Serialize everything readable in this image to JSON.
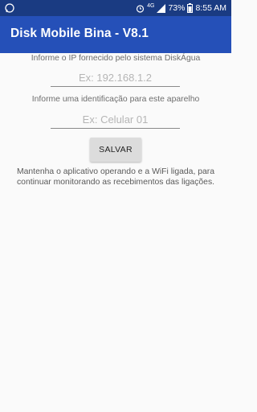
{
  "status_bar": {
    "network": "4G",
    "battery": "73%",
    "time": "8:55 AM",
    "icons": [
      "whatsapp-icon",
      "alarm-icon",
      "lte-icon",
      "signal-icon",
      "battery-icon"
    ]
  },
  "app_bar": {
    "title": "Disk Mobile Bina - V8.1",
    "background": "#2550b8",
    "status_background": "#1a3b82"
  },
  "form": {
    "ip_label": "Informe o IP fornecido pelo sistema DiskÁgua",
    "ip_placeholder": "Ex: 192.168.1.2",
    "ip_value": "",
    "id_label": "Informe uma identificação para este aparelho",
    "id_placeholder": "Ex: Celular 01",
    "id_value": "",
    "save_label": "SALVAR"
  },
  "message": {
    "text": "Mantenha o aplicativo operando e a WiFi ligada, para continuar monitorando as recebimentos das ligações."
  }
}
